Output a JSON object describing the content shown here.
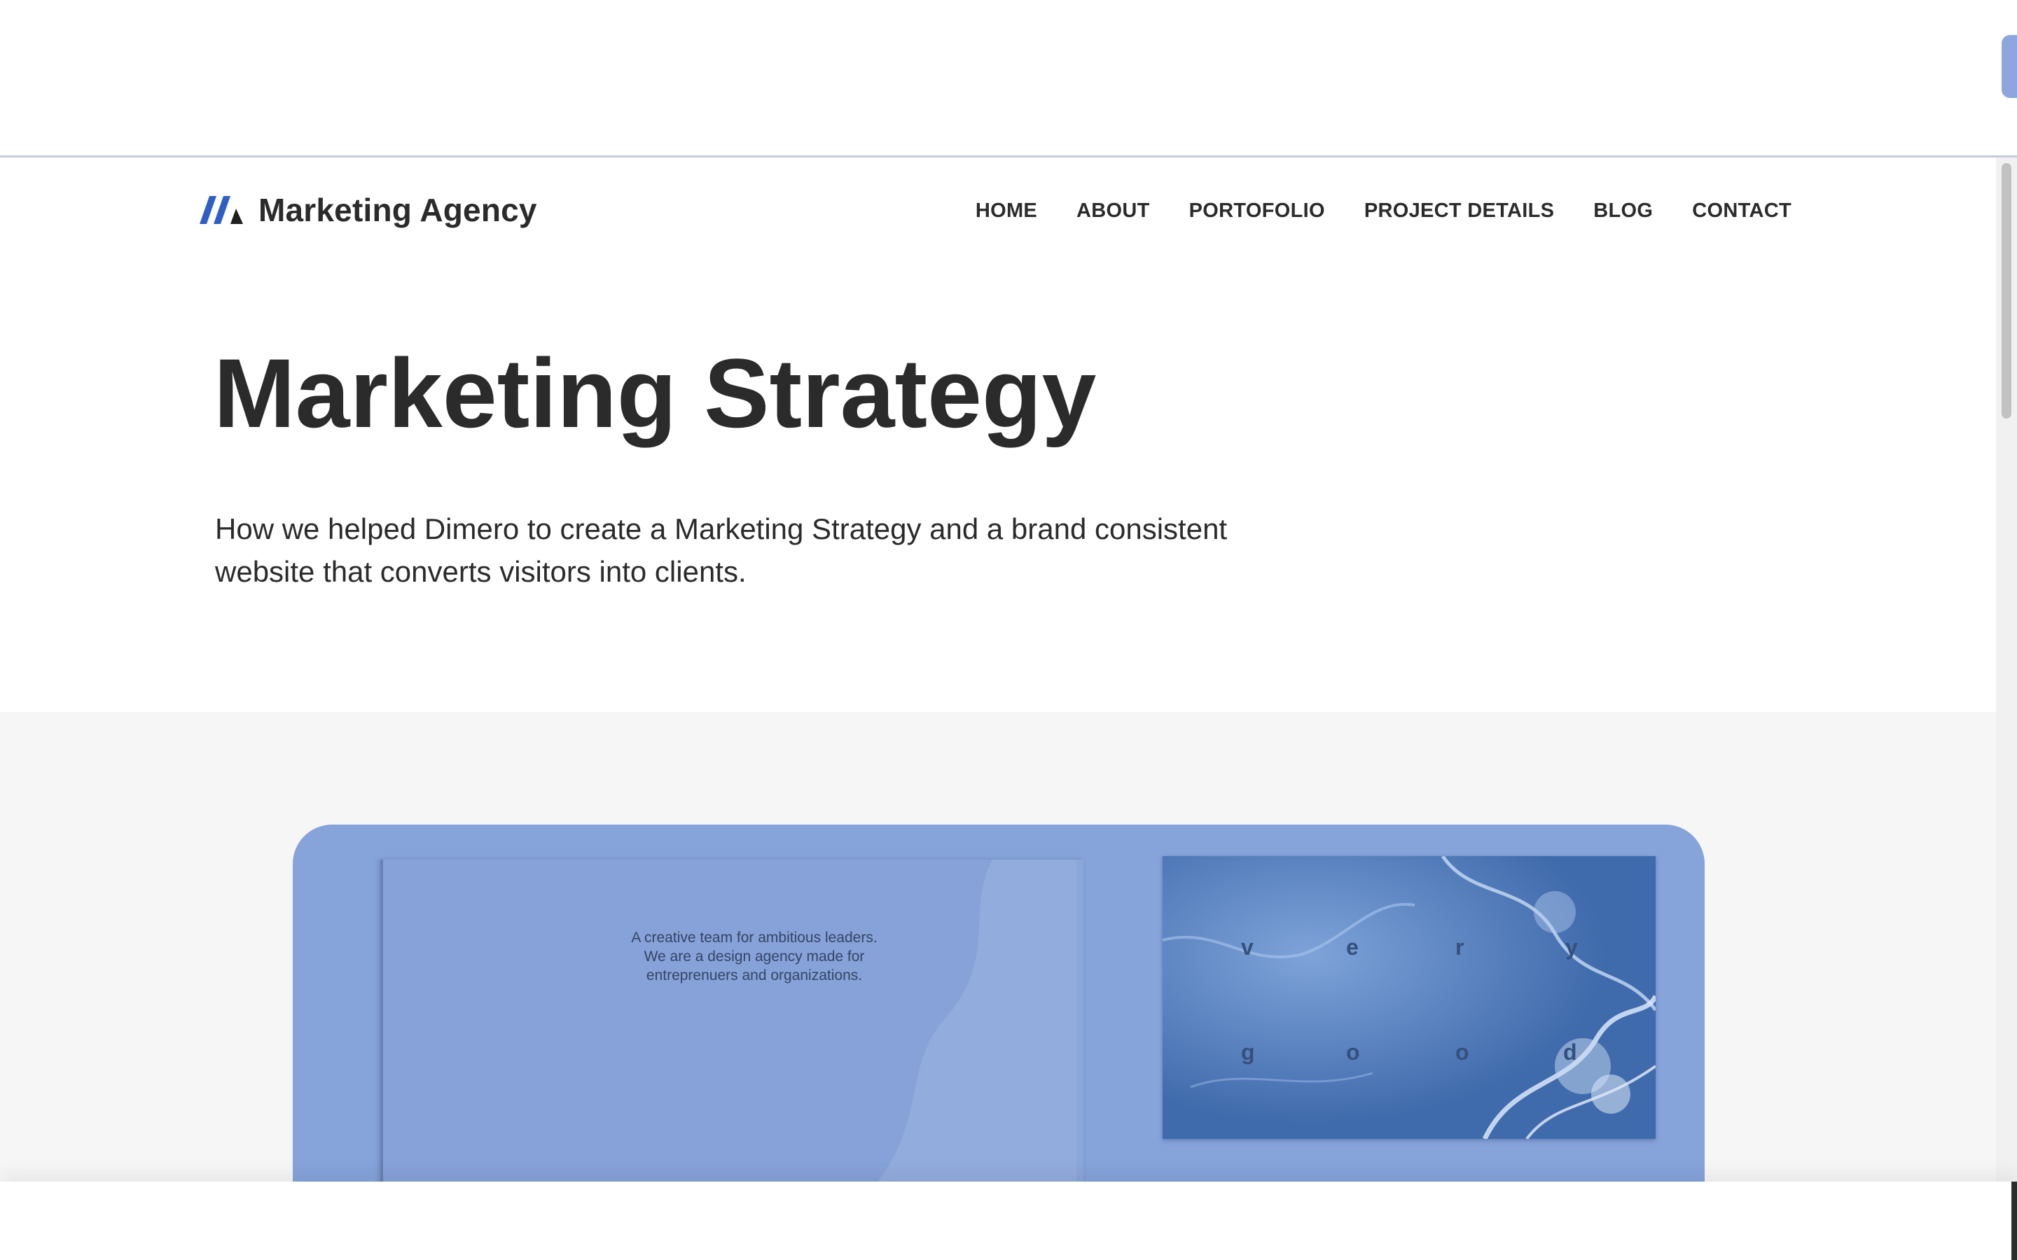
{
  "brand": {
    "name": "Marketing Agency",
    "logo_icon": "m-logo-icon",
    "accent": "#2f5fc4"
  },
  "nav": {
    "items": [
      {
        "label": "HOME"
      },
      {
        "label": "ABOUT"
      },
      {
        "label": "PORTOFOLIO"
      },
      {
        "label": "PROJECT DETAILS"
      },
      {
        "label": "BLOG"
      },
      {
        "label": "CONTACT"
      }
    ]
  },
  "hero": {
    "title": "Marketing Strategy",
    "subtitle_line1": "How we helped Dimero to create a Marketing Strategy and a brand consistent",
    "subtitle_line2": "website that converts visitors into clients."
  },
  "feature": {
    "card_color": "#86a3da",
    "paper_line1": "A creative team for ambitious leaders.",
    "paper_line2": "We are a design agency made for",
    "paper_line3": "entreprenuers and organizations.",
    "image_letters": [
      "v",
      "e",
      "r",
      "y",
      "g",
      "o",
      "o",
      "d"
    ]
  }
}
